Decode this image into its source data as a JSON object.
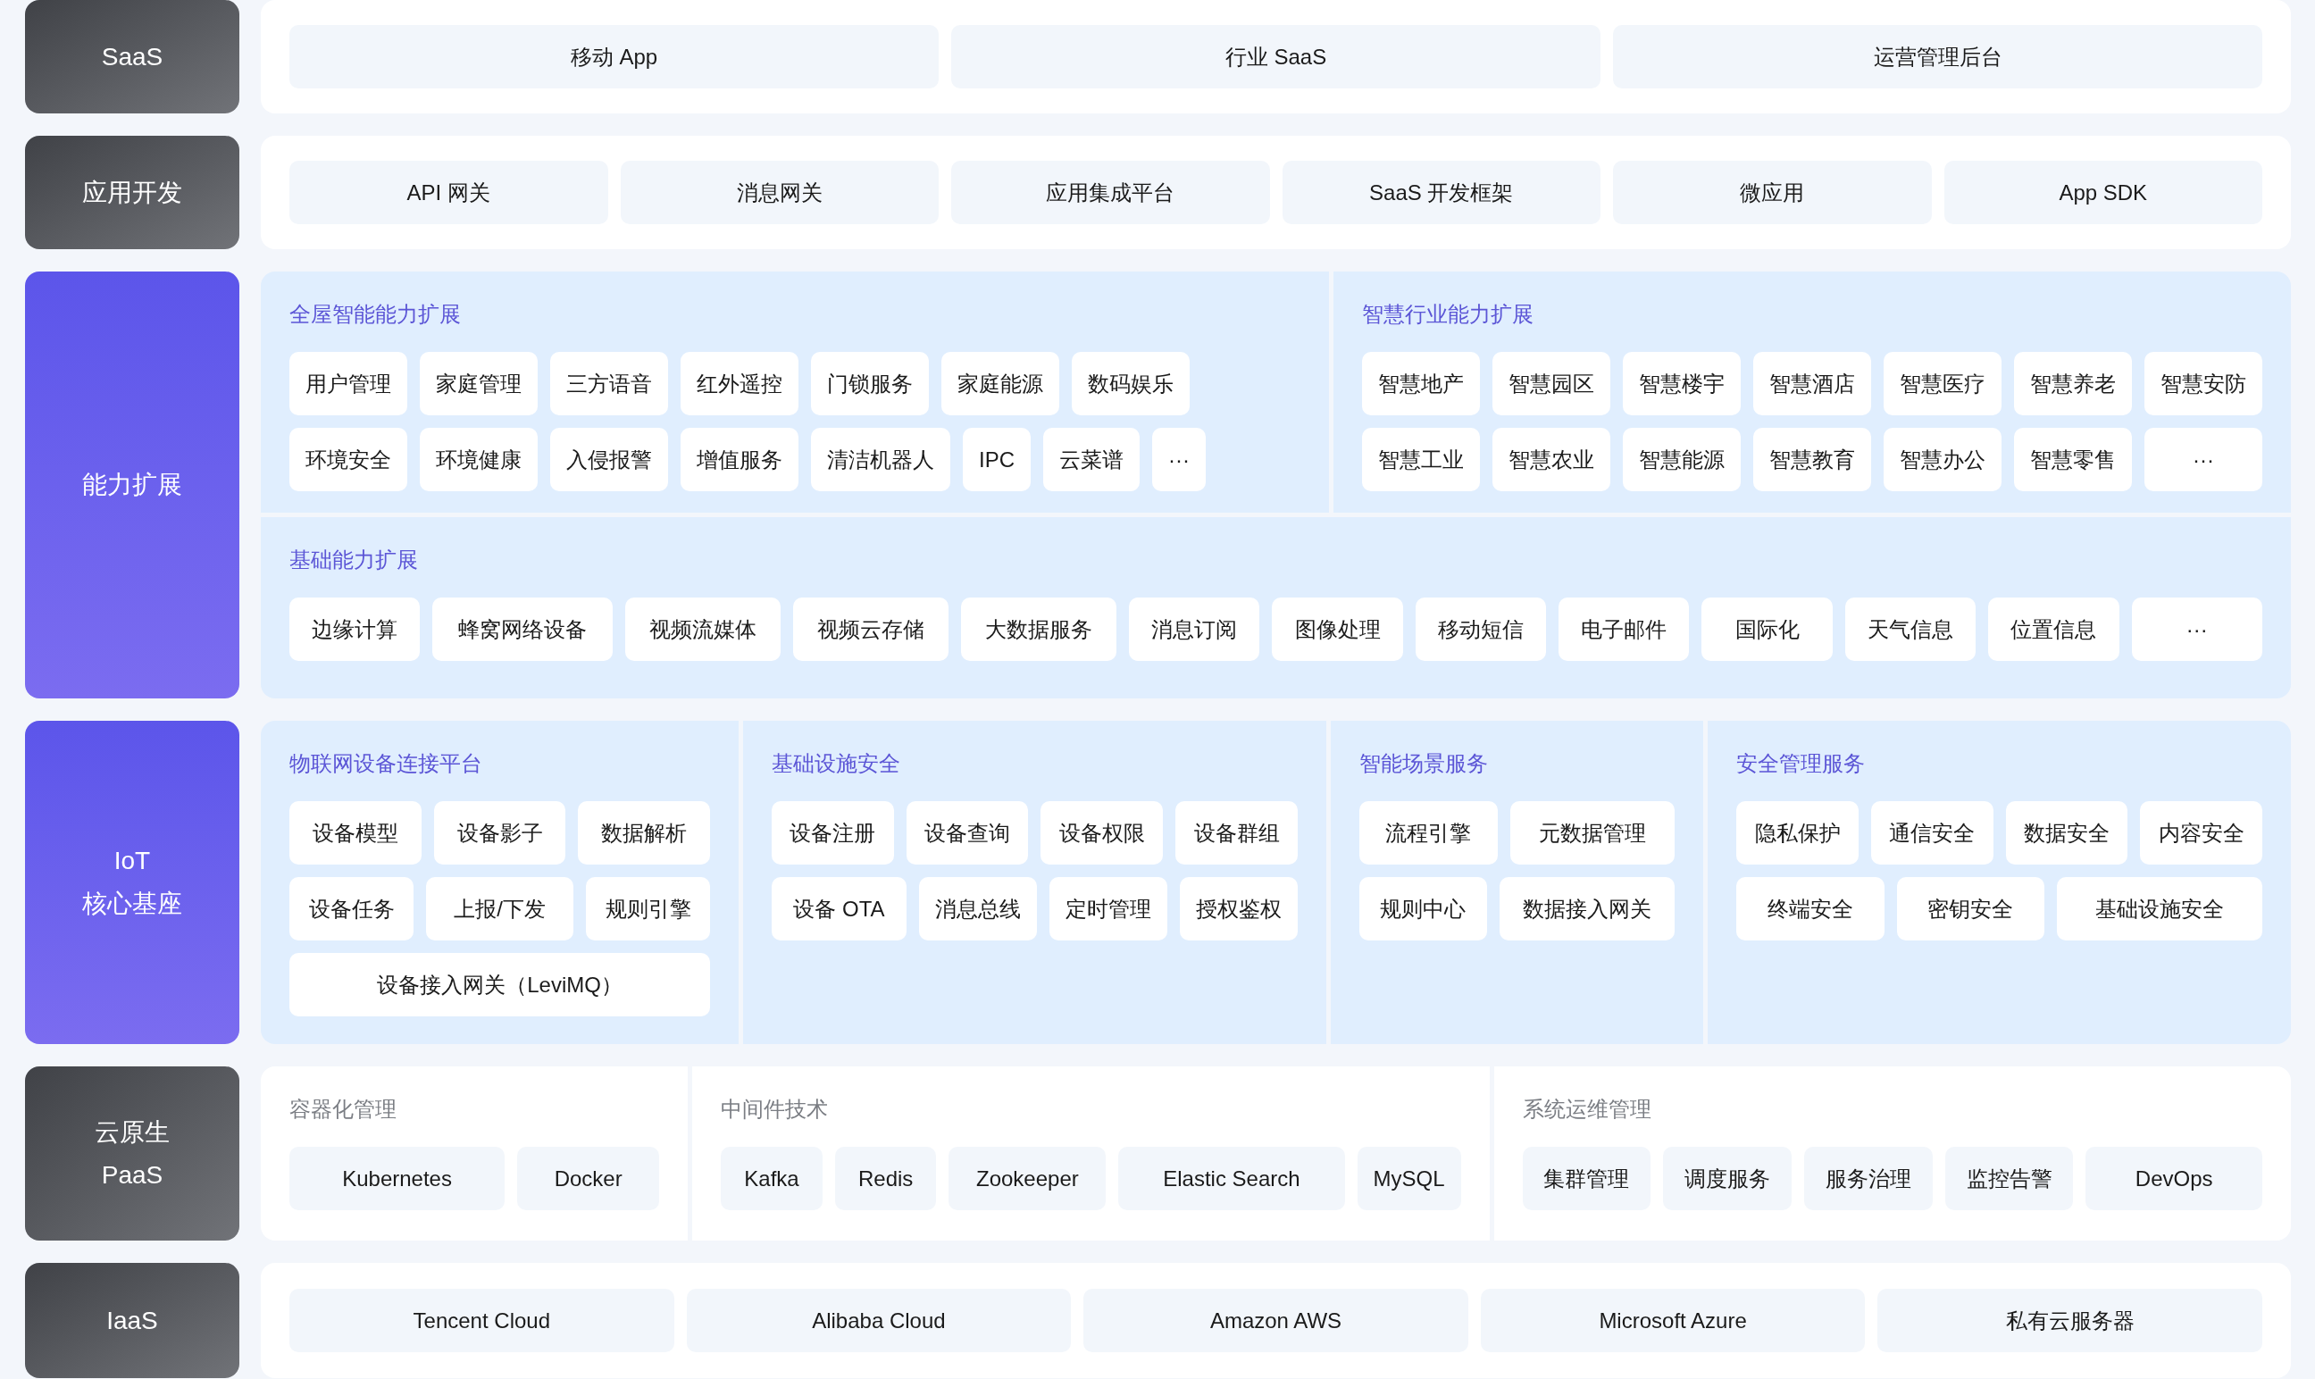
{
  "layers": [
    {
      "label": "SaaS",
      "kind": "dark",
      "items": [
        "移动 App",
        "行业 SaaS",
        "运营管理后台"
      ]
    },
    {
      "label": "应用开发",
      "kind": "dark",
      "items": [
        "API 网关",
        "消息网关",
        "应用集成平台",
        "SaaS 开发框架",
        "微应用",
        "App SDK"
      ]
    },
    {
      "label": "能力扩展",
      "kind": "accent",
      "group_rows": [
        [
          {
            "title": "全屋智能能力扩展",
            "kind": "compact",
            "rows": [
              [
                "用户管理",
                "家庭管理",
                "三方语音",
                "红外遥控",
                "门锁服务",
                "家庭能源",
                "数码娱乐"
              ],
              [
                "环境安全",
                "环境健康",
                "入侵报警",
                "增值服务",
                "清洁机器人",
                "IPC",
                "云菜谱",
                "···"
              ]
            ]
          },
          {
            "title": "智慧行业能力扩展",
            "rows": [
              [
                "智慧地产",
                "智慧园区",
                "智慧楼宇",
                "智慧酒店",
                "智慧医疗",
                "智慧养老",
                "智慧安防"
              ],
              [
                "智慧工业",
                "智慧农业",
                "智慧能源",
                "智慧教育",
                "智慧办公",
                "智慧零售",
                "···"
              ]
            ]
          }
        ],
        [
          {
            "title": "基础能力扩展",
            "rows": [
              [
                "边缘计算",
                "蜂窝网络设备",
                "视频流媒体",
                "视频云存储",
                "大数据服务",
                "消息订阅",
                "图像处理",
                "移动短信",
                "电子邮件",
                "国际化",
                "天气信息",
                "位置信息",
                "···"
              ]
            ]
          }
        ]
      ]
    },
    {
      "label": "IoT\n核心基座",
      "kind": "accent",
      "group_rows": [
        [
          {
            "title": "物联网设备连接平台",
            "rows": [
              [
                "设备模型",
                "设备影子",
                "数据解析"
              ],
              [
                "设备任务",
                "上报/下发",
                "规则引擎"
              ],
              [
                "设备接入网关（LeviMQ）"
              ]
            ]
          },
          {
            "title": "基础设施安全",
            "rows": [
              [
                "设备注册",
                "设备查询",
                "设备权限",
                "设备群组"
              ],
              [
                "设备 OTA",
                "消息总线",
                "定时管理",
                "授权鉴权"
              ]
            ]
          },
          {
            "title": "智能场景服务",
            "rows": [
              [
                "流程引擎",
                "元数据管理"
              ],
              [
                "规则中心",
                "数据接入网关"
              ]
            ]
          },
          {
            "title": "安全管理服务",
            "rows": [
              [
                "隐私保护",
                "通信安全",
                "数据安全",
                "内容安全"
              ],
              [
                "终端安全",
                "密钥安全",
                "基础设施安全"
              ]
            ]
          }
        ]
      ]
    },
    {
      "label": "云原生\nPaaS",
      "kind": "dark",
      "group_rows": [
        [
          {
            "title": "容器化管理",
            "rows": [
              [
                "Kubernetes",
                "Docker"
              ]
            ]
          },
          {
            "title": "中间件技术",
            "rows": [
              [
                "Kafka",
                "Redis",
                "Zookeeper",
                "Elastic Search",
                "MySQL"
              ]
            ]
          },
          {
            "title": "系统运维管理",
            "rows": [
              [
                "集群管理",
                "调度服务",
                "服务治理",
                "监控告警",
                "DevOps"
              ]
            ]
          }
        ]
      ]
    },
    {
      "label": "IaaS",
      "kind": "dark",
      "items": [
        "Tencent Cloud",
        "Alibaba Cloud",
        "Amazon AWS",
        "Microsoft Azure",
        "私有云服务器"
      ]
    }
  ]
}
